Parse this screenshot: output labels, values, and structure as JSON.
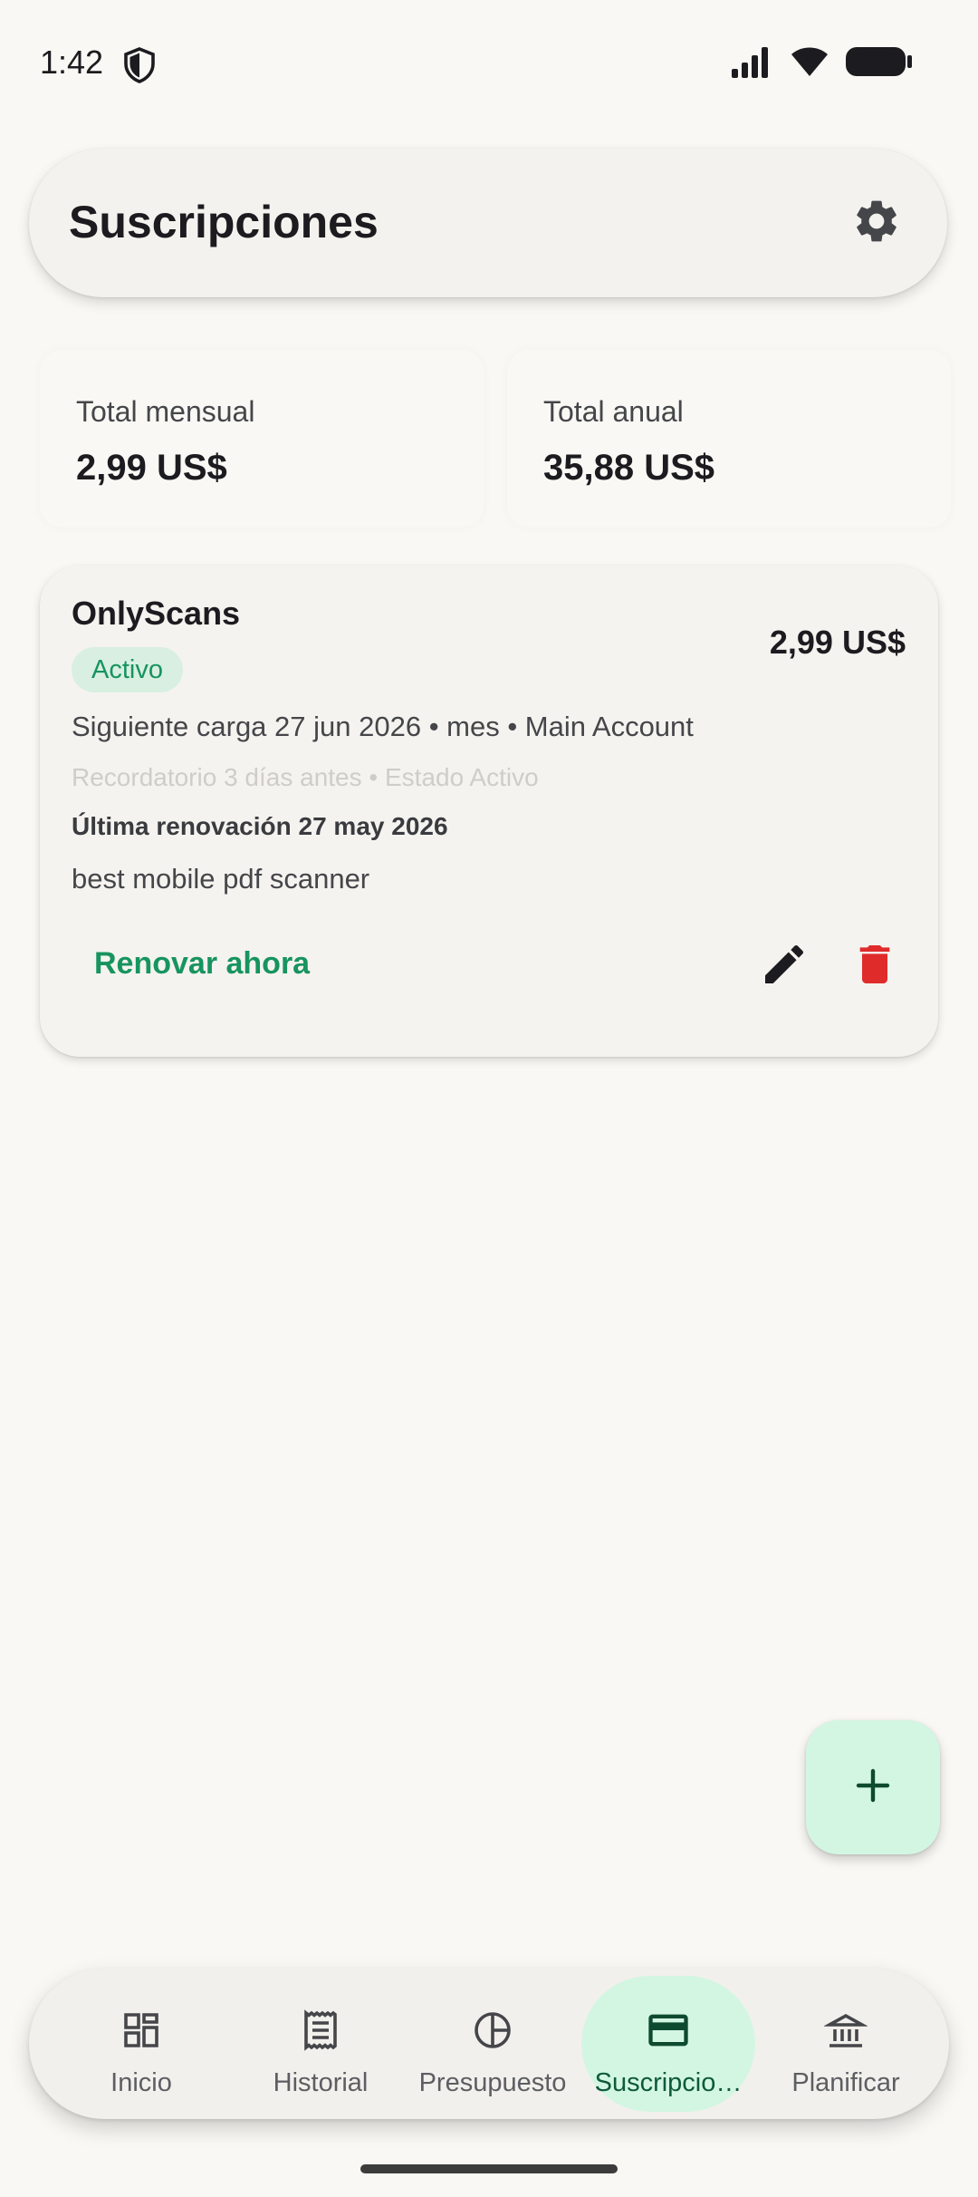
{
  "status_bar": {
    "time": "1:42"
  },
  "header": {
    "title": "Suscripciones"
  },
  "totals": {
    "monthly_label": "Total mensual",
    "monthly_value": "2,99 US$",
    "yearly_label": "Total anual",
    "yearly_value": "35,88 US$"
  },
  "subscription": {
    "name": "OnlyScans",
    "price": "2,99 US$",
    "status": "Activo",
    "next_charge": "Siguiente carga 27 jun 2026 • mes • Main Account",
    "reminder": "Recordatorio 3 días antes • Estado Activo",
    "last_renewal": "Última renovación 27 may 2026",
    "description": "best mobile pdf scanner",
    "renew_label": "Renovar ahora"
  },
  "nav": {
    "items": [
      {
        "label": "Inicio",
        "icon": "dashboard-icon"
      },
      {
        "label": "Historial",
        "icon": "receipt-icon"
      },
      {
        "label": "Presupuesto",
        "icon": "pie-chart-icon"
      },
      {
        "label": "Suscripcio…",
        "icon": "credit-card-icon"
      },
      {
        "label": "Planificar",
        "icon": "bank-icon"
      }
    ],
    "active_index": 3
  },
  "colors": {
    "accent": "#17945f",
    "badge_bg": "#d9efe2",
    "fab_bg": "#d3f6e3",
    "delete": "#e02b2b"
  }
}
